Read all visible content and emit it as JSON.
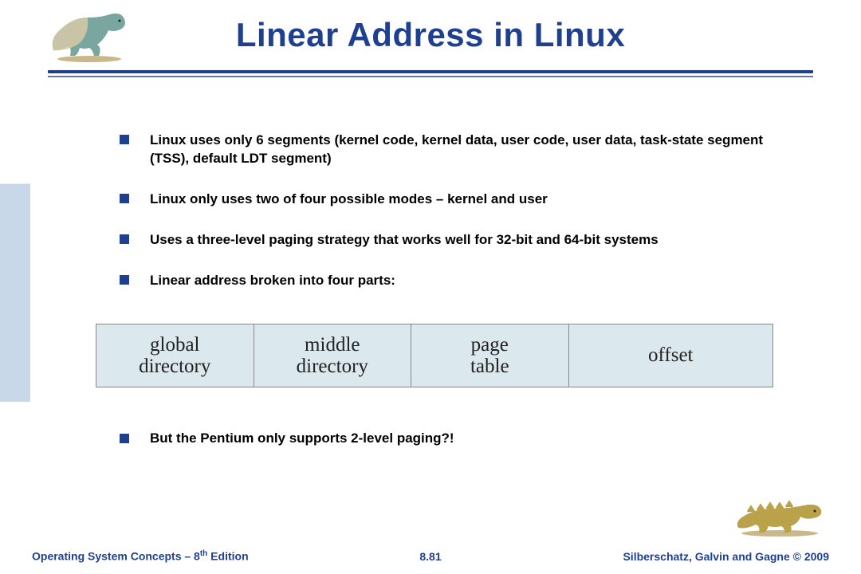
{
  "title": "Linear Address in Linux",
  "bullets": [
    "Linux uses only 6 segments (kernel code, kernel data, user code, user data, task-state segment (TSS), default LDT segment)",
    "Linux only uses two of four possible modes – kernel and user",
    "Uses a three-level paging strategy that works well for 32-bit and 64-bit systems",
    "Linear address broken into four parts:"
  ],
  "diagram": {
    "cells": [
      "global\ndirectory",
      "middle\ndirectory",
      "page\ntable",
      "offset"
    ]
  },
  "after_bullet": "But the Pentium only supports 2-level paging?!",
  "footer": {
    "left_a": "Operating System Concepts – 8",
    "left_th": "th",
    "left_b": " Edition",
    "center": "8.81",
    "right": "Silberschatz, Galvin and Gagne © 2009"
  }
}
